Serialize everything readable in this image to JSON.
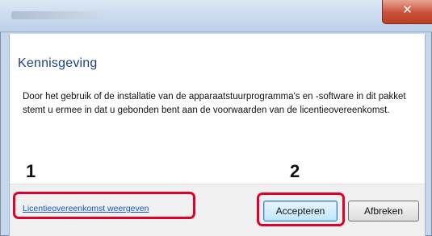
{
  "window": {
    "close_glyph": "✕"
  },
  "dialog": {
    "heading": "Kennisgeving",
    "message": "Door het gebruik of de installatie van de apparaatstuurprogramma's en -software in dit pakket stemt u ermee in dat u gebonden bent aan de voorwaarden van de licentieovereenkomst."
  },
  "footer": {
    "link_label": "Licentieovereenkomst weergeven",
    "accept_label": "Accepteren",
    "cancel_label": "Afbreken"
  },
  "callouts": {
    "one": "1",
    "two": "2"
  },
  "colors": {
    "highlight": "#e0002a",
    "heading": "#1e3f8a",
    "link": "#1a56c5"
  }
}
